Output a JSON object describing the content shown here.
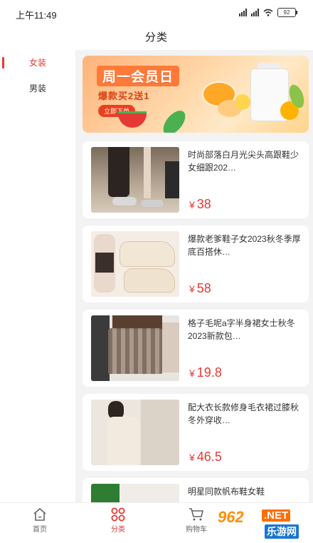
{
  "status_bar": {
    "time": "上午11:49",
    "battery": "92"
  },
  "header": {
    "title": "分类"
  },
  "sidebar": {
    "items": [
      {
        "label": "女装",
        "active": true
      },
      {
        "label": "男装",
        "active": false
      }
    ]
  },
  "banner": {
    "title": "周一会员日",
    "subtitle": "爆款买2送1",
    "button": "立即下单"
  },
  "products": [
    {
      "title": "时尚部落白月光尖头高跟鞋少女细跟202…",
      "currency": "¥",
      "price": "38"
    },
    {
      "title": "爆款老爹鞋子女2023秋冬季厚底百搭休…",
      "currency": "¥",
      "price": "58"
    },
    {
      "title": "格子毛呢a字半身裙女士秋冬2023新款包…",
      "currency": "¥",
      "price": "19.8"
    },
    {
      "title": "配大衣长款修身毛衣裙过膝秋冬外穿收…",
      "currency": "¥",
      "price": "46.5"
    },
    {
      "title": "明星同款帆布鞋女鞋",
      "currency": "¥",
      "price": ""
    }
  ],
  "tabbar": {
    "items": [
      {
        "label": "首页"
      },
      {
        "label": "分类",
        "active": true
      },
      {
        "label": "购物车"
      }
    ]
  },
  "watermark": {
    "number": "962",
    "net": ".NET",
    "name": "乐游网"
  },
  "colors": {
    "accent": "#e53935",
    "background": "#f3f3f3"
  }
}
